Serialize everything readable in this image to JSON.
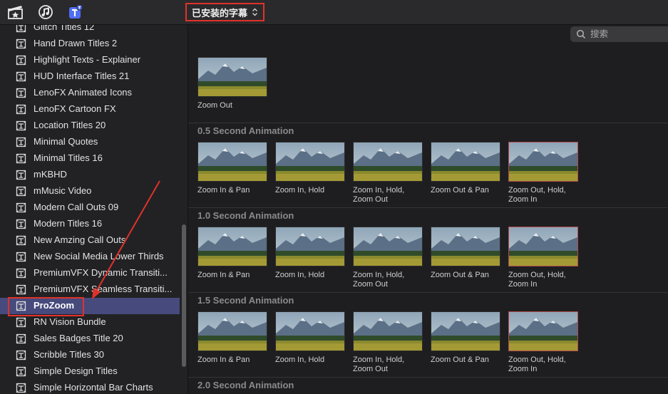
{
  "toolbar": {
    "icons": [
      "clapper-star-icon",
      "music-note-icon",
      "titles-icon"
    ],
    "dropdown_label": "已安装的字幕",
    "dropdown_chevron": "⌃⌄"
  },
  "search": {
    "placeholder": "搜索"
  },
  "sidebar": {
    "items": [
      "Glitch Titles 12",
      "Hand Drawn Titles 2",
      "Highlight Texts - Explainer",
      "HUD Interface Titles 21",
      "LenoFX Animated Icons",
      "LenoFX Cartoon FX",
      "Location Titles 20",
      "Minimal Quotes",
      "Minimal Titles 16",
      "mKBHD",
      "mMusic Video",
      "Modern Call Outs 09",
      "Modern Titles 16",
      "New Amzing Call Outs",
      "New Social Media Lower Thirds",
      "PremiumVFX Dynamic Transiti...",
      "PremiumVFX Seamless Transiti...",
      "ProZoom",
      "RN Vision Bundle",
      "Sales Badges Title 20",
      "Scribble Titles 30",
      "Simple Design Titles",
      "Simple Horizontal Bar Charts"
    ],
    "selected": "ProZoom"
  },
  "main": {
    "top_tile": {
      "caption": "Zoom Out"
    },
    "sections": [
      {
        "title": "0.5 Second Animation",
        "tiles": [
          "Zoom In & Pan",
          "Zoom In, Hold",
          "Zoom In, Hold,\nZoom Out",
          "Zoom Out & Pan",
          "Zoom Out, Hold,\nZoom In"
        ]
      },
      {
        "title": "1.0 Second Animation",
        "tiles": [
          "Zoom In & Pan",
          "Zoom In, Hold",
          "Zoom In, Hold,\nZoom Out",
          "Zoom Out & Pan",
          "Zoom Out, Hold,\nZoom In"
        ]
      },
      {
        "title": "1.5 Second Animation",
        "tiles": [
          "Zoom In & Pan",
          "Zoom In, Hold",
          "Zoom In, Hold,\nZoom Out",
          "Zoom Out & Pan",
          "Zoom Out, Hold,\nZoom In"
        ]
      },
      {
        "title": "2.0 Second Animation",
        "tiles": []
      }
    ]
  },
  "colors": {
    "highlight": "#e0322a",
    "selection": "#474a7c",
    "toolbar_accent": "#4f6df5"
  }
}
